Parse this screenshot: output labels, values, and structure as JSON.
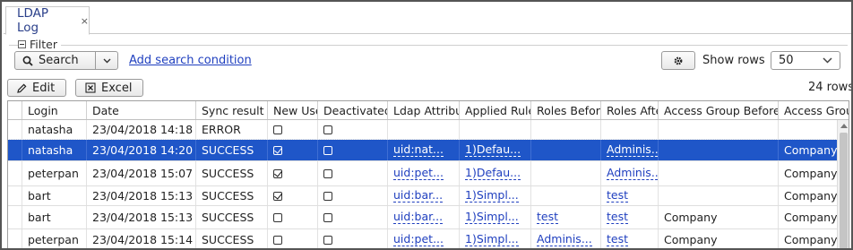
{
  "tab": {
    "title": "LDAP Log",
    "close": "×"
  },
  "filter": {
    "legend": "Filter",
    "search_label": "Search",
    "add_condition": "Add search condition",
    "show_rows_label": "Show rows",
    "rows_value": "50"
  },
  "toolbar": {
    "edit_label": "Edit",
    "excel_label": "Excel",
    "row_count": "24 rows"
  },
  "table": {
    "headers": [
      "",
      "Login",
      "Date",
      "Sync result",
      "New User",
      "Deactivated",
      "Ldap Attributes",
      "Applied Rules",
      "Roles Before",
      "Roles After",
      "Access Group Before",
      "Access Group After"
    ],
    "rows": [
      {
        "login": "natasha",
        "date": "23/04/2018 14:18",
        "result": "ERROR",
        "new_user": false,
        "deactivated": false,
        "ldap": "",
        "rules": "",
        "roles_before": "",
        "roles_after": "",
        "ag_before": "",
        "ag_after": ""
      },
      {
        "login": "natasha",
        "date": "23/04/2018 14:20",
        "result": "SUCCESS",
        "new_user": true,
        "deactivated": false,
        "ldap": "uid:nat...",
        "rules": "1)Defau...",
        "roles_before": "",
        "roles_after": "Adminis...",
        "ag_before": "",
        "ag_after": "Company"
      },
      {
        "login": "peterpan",
        "date": "23/04/2018 15:07",
        "result": "SUCCESS",
        "new_user": true,
        "deactivated": false,
        "ldap": "uid:pet...",
        "rules": "1)Defau...",
        "roles_before": "",
        "roles_after": "Adminis...",
        "ag_before": "",
        "ag_after": "Company"
      },
      {
        "login": "bart",
        "date": "23/04/2018 15:13",
        "result": "SUCCESS",
        "new_user": true,
        "deactivated": false,
        "ldap": "uid:bar...",
        "rules": "1)Simpl...",
        "roles_before": "",
        "roles_after": "test",
        "ag_before": "",
        "ag_after": "Company"
      },
      {
        "login": "bart",
        "date": "23/04/2018 15:13",
        "result": "SUCCESS",
        "new_user": false,
        "deactivated": false,
        "ldap": "uid:bar...",
        "rules": "1)Simpl...",
        "roles_before": "test",
        "roles_after": "test",
        "ag_before": "Company",
        "ag_after": "Company"
      },
      {
        "login": "peterpan",
        "date": "23/04/2018 15:14",
        "result": "SUCCESS",
        "new_user": false,
        "deactivated": false,
        "ldap": "uid:pet...",
        "rules": "1)Simpl...",
        "roles_before": "Adminis...",
        "roles_after": "test",
        "ag_before": "Company",
        "ag_after": "Company"
      }
    ]
  },
  "colors": {
    "selection": "#1f56c8",
    "link": "#1f3fbf"
  }
}
